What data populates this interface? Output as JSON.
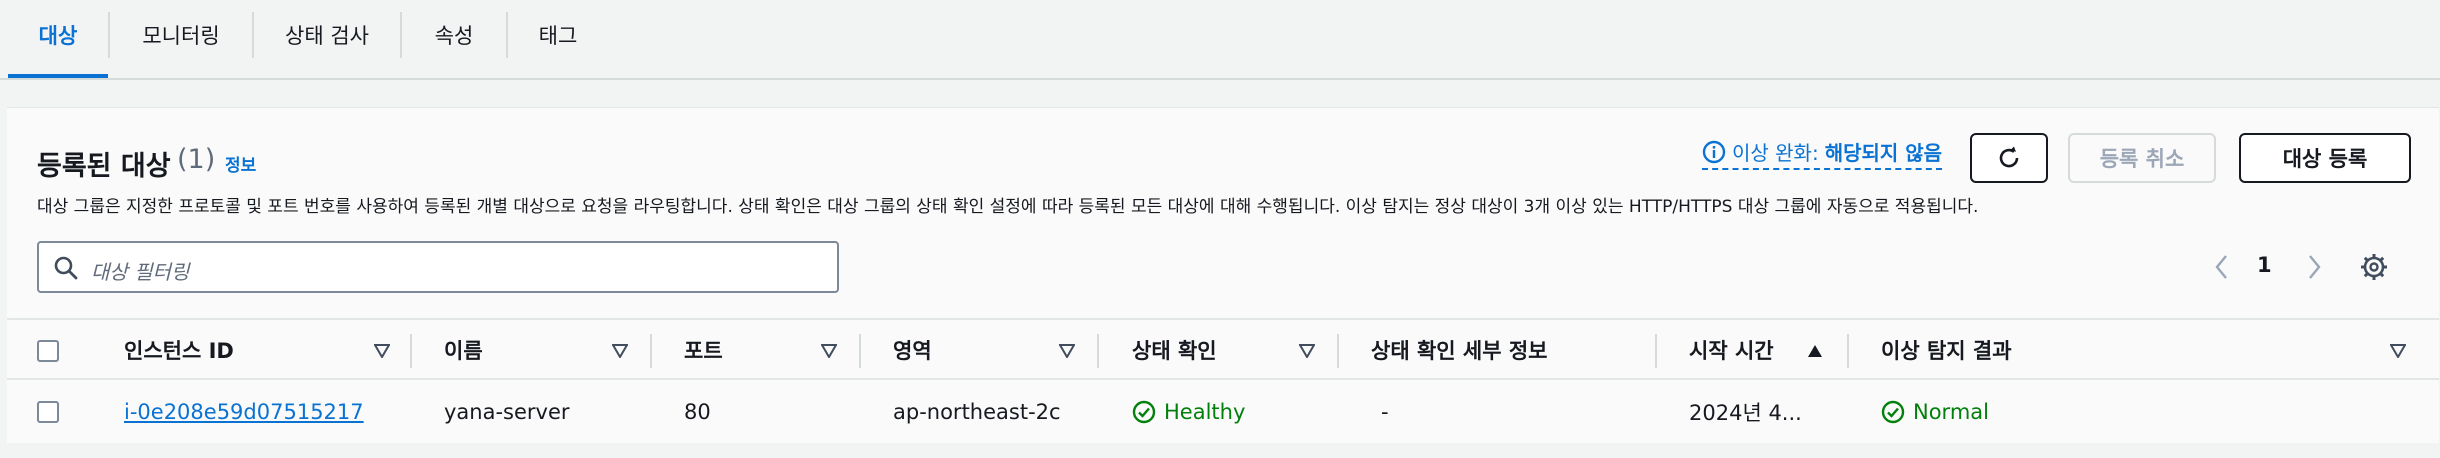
{
  "tabs": [
    {
      "label": "대상"
    },
    {
      "label": "모니터링"
    },
    {
      "label": "상태 검사"
    },
    {
      "label": "속성"
    },
    {
      "label": "태그"
    }
  ],
  "panel": {
    "title": "등록된 대상",
    "count": "(1)",
    "info_link": "정보",
    "description": "대상 그룹은 지정한 프로토콜 및 포트 번호를 사용하여 등록된 개별 대상으로 요청을 라우팅합니다. 상태 확인은 대상 그룹의 상태 확인 설정에 따라 등록된 모든 대상에 대해 수행됩니다. 이상 탐지는 정상 대상이 3개 이상 있는 HTTP/HTTPS 대상 그룹에 자동으로 적용됩니다.",
    "anomaly_label": "이상 완화:",
    "anomaly_value": "해당되지 않음",
    "deregister_label": "등록 취소",
    "register_label": "대상 등록",
    "search_placeholder": "대상 필터링",
    "page": "1"
  },
  "table": {
    "columns": [
      "인스턴스 ID",
      "이름",
      "포트",
      "영역",
      "상태 확인",
      "상태 확인 세부 정보",
      "시작 시간",
      "이상 탐지 결과"
    ],
    "rows": [
      {
        "instance_id": "i-0e208e59d07515217",
        "name": "yana-server",
        "port": "80",
        "zone": "ap-northeast-2c",
        "health": "Healthy",
        "health_detail": "-",
        "launch_time": "2024년 4...",
        "anomaly": "Normal"
      }
    ]
  },
  "colors": {
    "accent": "#0972d3",
    "success": "#037f0c",
    "background": "#f2f3f3"
  },
  "icons": [
    "info-icon",
    "refresh-icon",
    "search-icon",
    "chevron-left-icon",
    "chevron-right-icon",
    "gear-icon",
    "sort-down-icon",
    "sort-up-icon",
    "check-circle-icon"
  ]
}
